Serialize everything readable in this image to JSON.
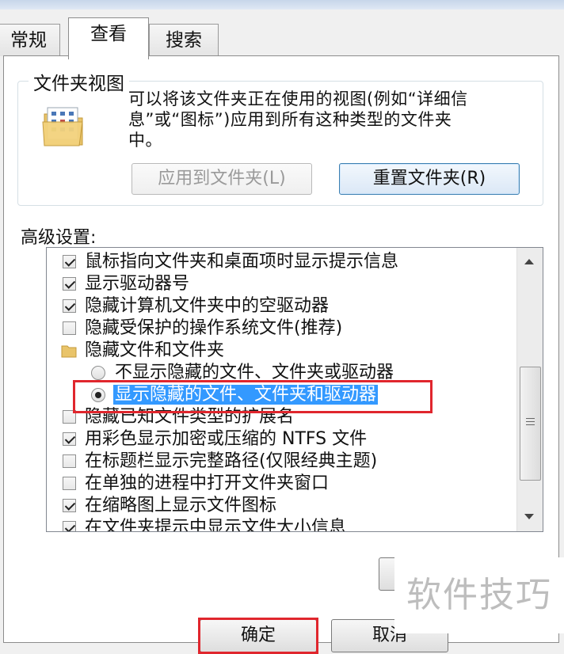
{
  "tabs": [
    {
      "label": "常规"
    },
    {
      "label": "查看"
    },
    {
      "label": "搜索"
    }
  ],
  "folder_view": {
    "group_label": "文件夹视图",
    "description_lines": [
      "可以将该文件夹正在使用的视图(例如“详细信",
      "息”或“图标”)应用到所有这种类型的文件夹",
      "中。"
    ],
    "apply_button": "应用到文件夹(L)",
    "reset_button": "重置文件夹(R)"
  },
  "advanced": {
    "label": "高级设置:",
    "items": [
      {
        "type": "checkbox",
        "checked": true,
        "label": "鼠标指向文件夹和桌面项时显示提示信息"
      },
      {
        "type": "checkbox",
        "checked": true,
        "label": "显示驱动器号"
      },
      {
        "type": "checkbox",
        "checked": true,
        "label": "隐藏计算机文件夹中的空驱动器"
      },
      {
        "type": "checkbox",
        "checked": false,
        "label": "隐藏受保护的操作系统文件(推荐)"
      },
      {
        "type": "folder",
        "label": "隐藏文件和文件夹"
      },
      {
        "type": "radio",
        "checked": false,
        "label": "不显示隐藏的文件、文件夹或驱动器"
      },
      {
        "type": "radio",
        "checked": true,
        "label": "显示隐藏的文件、文件夹和驱动器"
      },
      {
        "type": "checkbox",
        "checked": false,
        "label": "隐藏已知文件类型的扩展名"
      },
      {
        "type": "checkbox",
        "checked": true,
        "label": "用彩色显示加密或压缩的 NTFS 文件"
      },
      {
        "type": "checkbox",
        "checked": false,
        "label": "在标题栏显示完整路径(仅限经典主题)"
      },
      {
        "type": "checkbox",
        "checked": false,
        "label": "在单独的进程中打开文件夹窗口"
      },
      {
        "type": "checkbox",
        "checked": true,
        "label": "在缩略图上显示文件图标"
      },
      {
        "type": "checkbox",
        "checked": true,
        "label": "在文件夹提示中显示文件大小信息"
      }
    ]
  },
  "footer": {
    "ok_button": "确定",
    "cancel_button": "取消"
  },
  "watermark": "软件技巧",
  "colors": {
    "highlight": "#3399ff",
    "annotation_red": "#e0262d",
    "primary_button_border": "#3c7fb1"
  }
}
